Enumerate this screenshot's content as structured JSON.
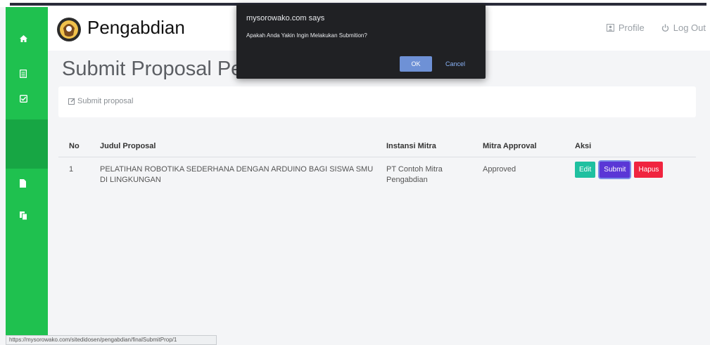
{
  "header": {
    "brand": "Pengabdian",
    "profile_label": "Profile",
    "logout_label": "Log Out"
  },
  "page": {
    "title": "Submit Proposal Pe",
    "breadcrumb": "Submit proposal"
  },
  "table": {
    "headers": [
      "No",
      "Judul Proposal",
      "Instansi Mitra",
      "Mitra Approval",
      "Aksi"
    ],
    "rows": [
      {
        "no": "1",
        "judul": "PELATIHAN ROBOTIKA SEDERHANA DENGAN ARDUINO BAGI SISWA SMU DI LINGKUNGAN",
        "instansi": "PT Contoh Mitra Pengabdian",
        "approval": "Approved",
        "actions": {
          "edit": "Edit",
          "submit": "Submit",
          "hapus": "Hapus"
        }
      }
    ]
  },
  "dialog": {
    "title": "mysorowako.com says",
    "message": "Apakah Anda Yakin Ingin Melakukan Submition?",
    "ok_label": "OK",
    "cancel_label": "Cancel"
  },
  "status_bar": {
    "url": "https://mysorowako.com/sitedidosen/pengabdian/finalSubmitProp/1"
  },
  "sidebar": {
    "icons": [
      "home-icon",
      "file-text-icon",
      "check-square-icon",
      "file-icon",
      "copy-icon"
    ]
  },
  "colors": {
    "sidebar": "#1fc14f",
    "edit": "#1fc0a0",
    "submit": "#5a37d6",
    "hapus": "#f0243f",
    "dialog_bg": "#202124",
    "ok": "#6e91d6"
  }
}
